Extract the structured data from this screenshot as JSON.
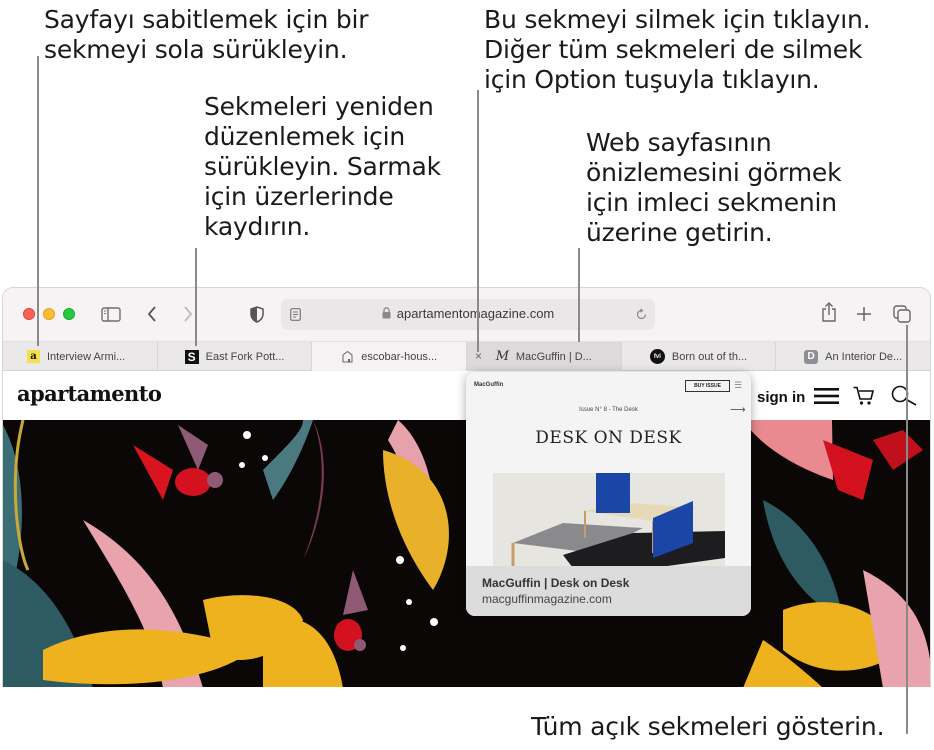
{
  "callouts": {
    "pin_tab": [
      "Sayfayı sabitlemek için bir",
      "sekmeyi sola sürükleyin."
    ],
    "reorder_tabs": [
      "Sekmeleri yeniden",
      "düzenlemek için",
      "sürükleyin. Sarmak",
      "için üzerlerinde",
      "kaydırın."
    ],
    "close_tab": [
      "Bu sekmeyi silmek için tıklayın.",
      "Diğer tüm sekmeleri de silmek",
      "için Option tuşuyla tıklayın."
    ],
    "preview": [
      "Web sayfasının",
      "önizlemesini görmek",
      "için imleci sekmenin",
      "üzerine getirin."
    ],
    "show_all_tabs": [
      "Tüm açık sekmeleri gösterin."
    ]
  },
  "browser": {
    "url": "apartamentomagazine.com",
    "tabs": [
      {
        "title": "Interview Armi...",
        "favicon": "a",
        "favicon_bg": "#f5e04a",
        "pinned": true
      },
      {
        "title": "East Fork Pott...",
        "favicon": "S",
        "favicon_bg": "#111111"
      },
      {
        "title": "escobar-hous...",
        "favicon": "page-icon"
      },
      {
        "title": "MacGuffin | D...",
        "favicon": "M",
        "active": true,
        "close_label": "×"
      },
      {
        "title": "Born out of th...",
        "favicon": "fvl",
        "favicon_bg": "#111111"
      },
      {
        "title": "An Interior De...",
        "favicon": "D",
        "favicon_bg": "#8e8e99"
      }
    ]
  },
  "site": {
    "logo": "apartamento",
    "sign_in": "sign in"
  },
  "preview": {
    "brand": "MacGuffin",
    "buy_button": "BUY ISSUE",
    "issue": "Issue N° 8 - The Desk",
    "headline": "DESK ON DESK",
    "page_title": "MacGuffin | Desk on Desk",
    "page_url": "macguffinmagazine.com"
  },
  "colors": {
    "close": "#ff5f57",
    "minimize": "#febc2e",
    "maximize": "#28c840",
    "preview_blue": "#1a46a8"
  }
}
